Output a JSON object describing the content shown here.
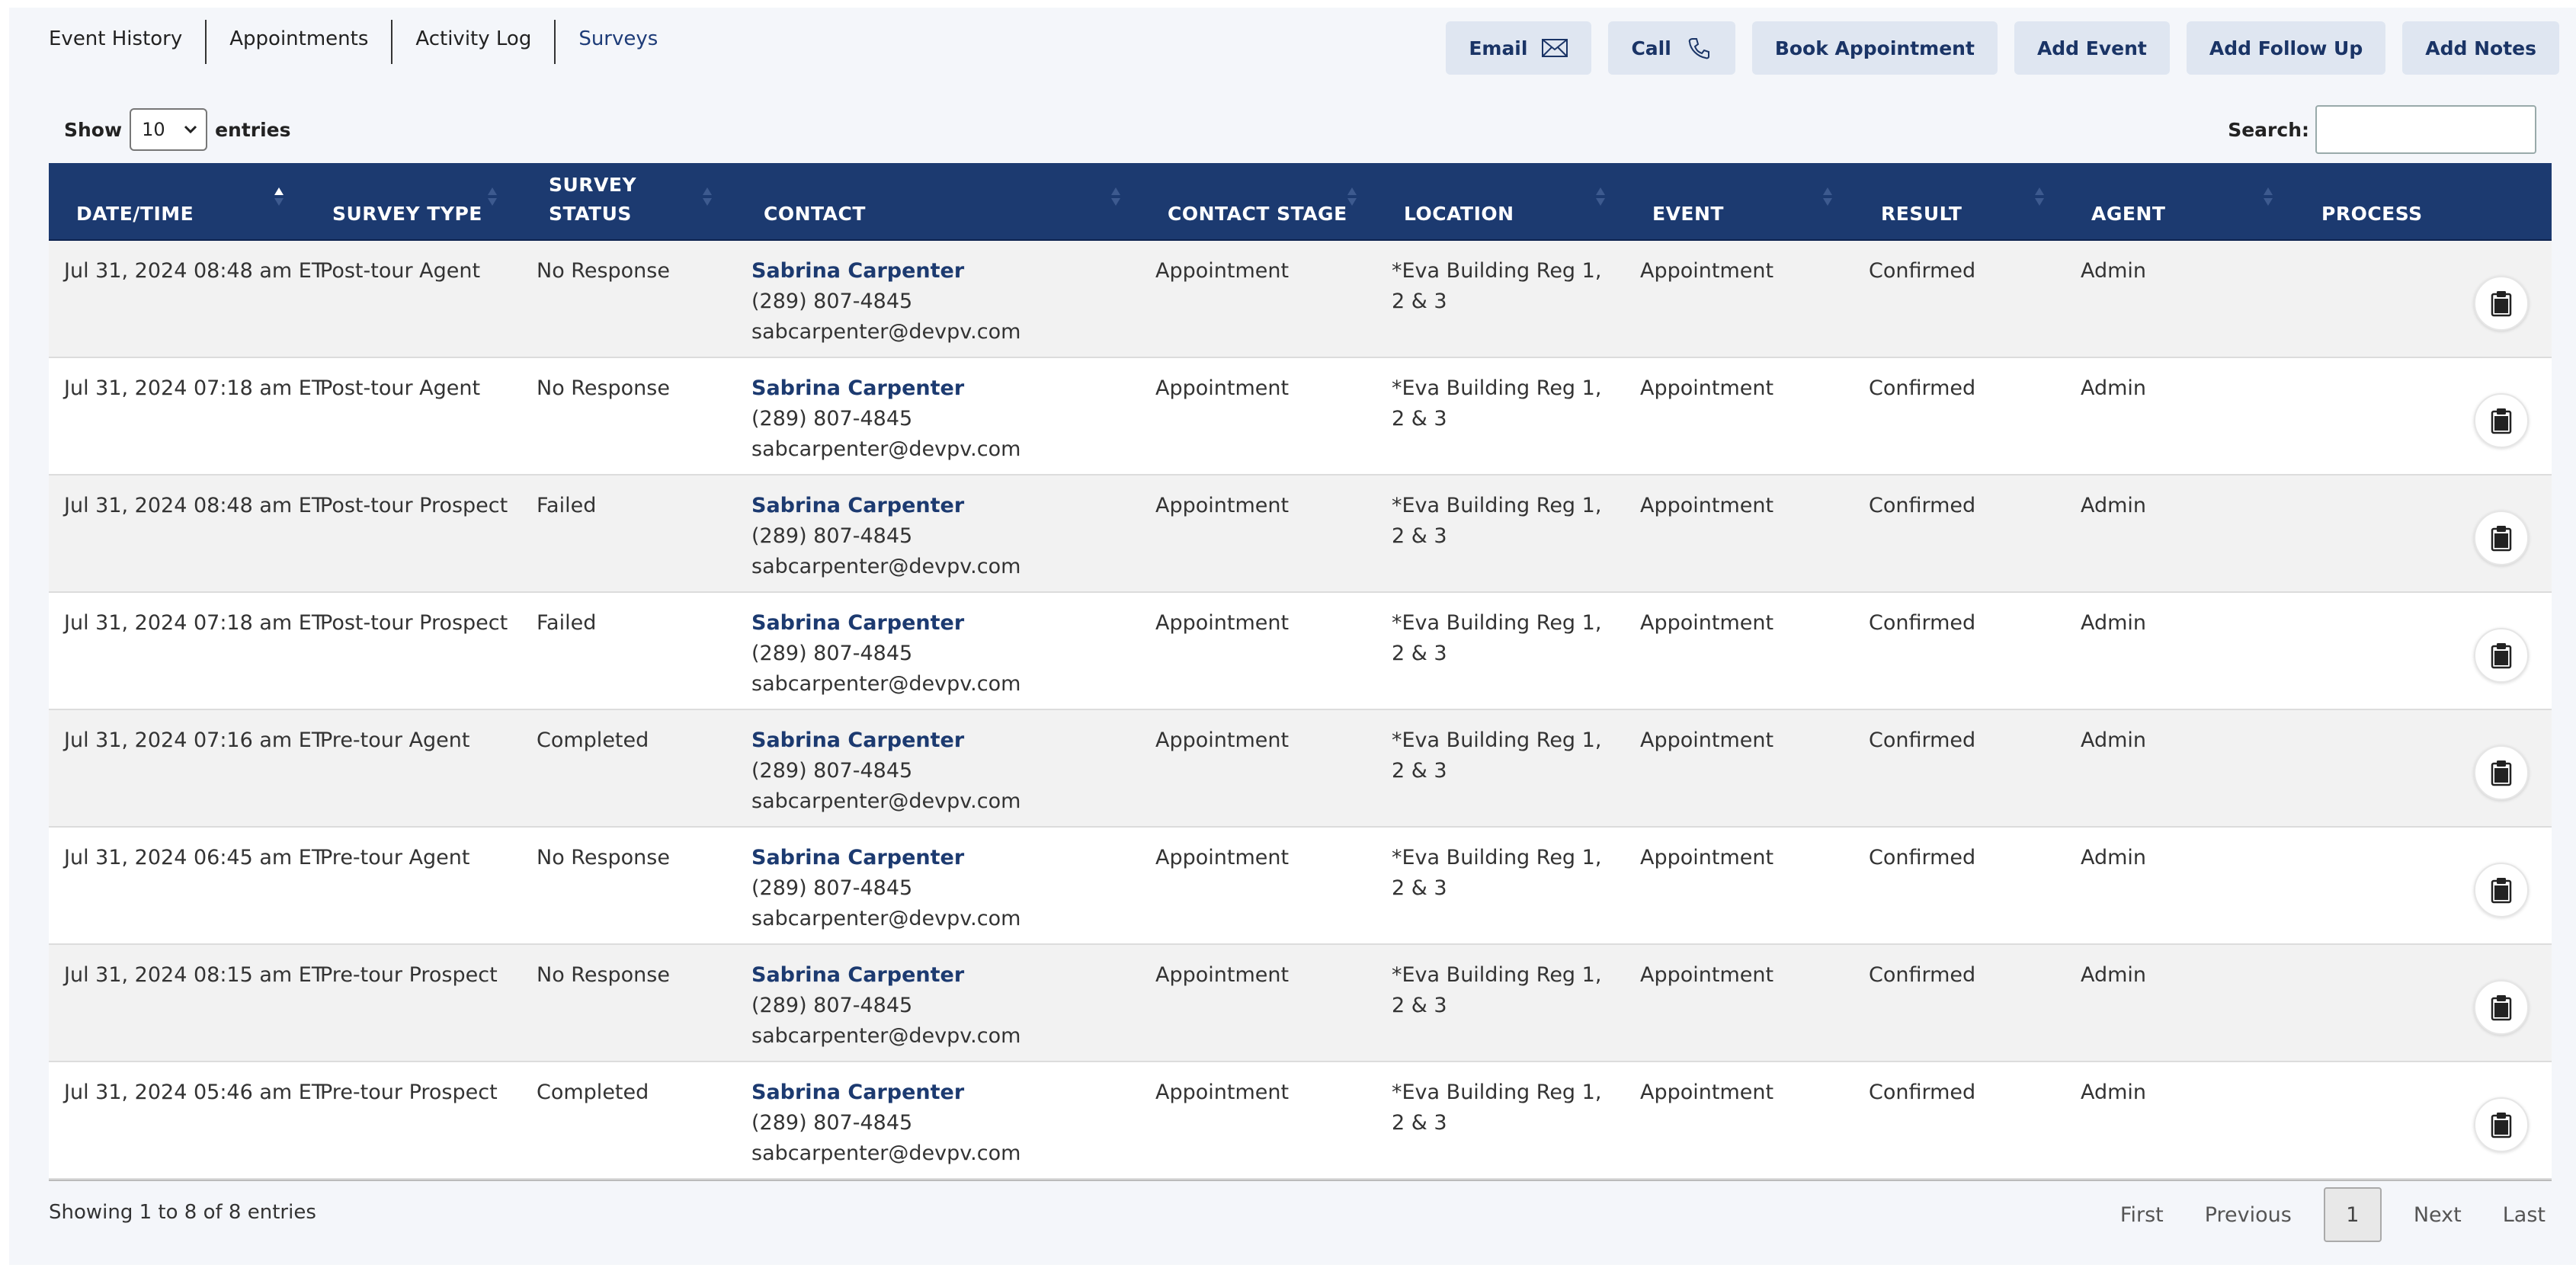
{
  "tabs": [
    {
      "label": "Event History",
      "active": false
    },
    {
      "label": "Appointments",
      "active": false
    },
    {
      "label": "Activity Log",
      "active": false
    },
    {
      "label": "Surveys",
      "active": true
    }
  ],
  "actions": {
    "email": "Email",
    "call": "Call",
    "book_appointment": "Book Appointment",
    "add_event": "Add Event",
    "add_follow_up": "Add Follow Up",
    "add_notes": "Add Notes"
  },
  "length": {
    "show_label": "Show",
    "value": "10",
    "entries_label": "entries"
  },
  "search": {
    "label": "Search:",
    "value": ""
  },
  "columns": {
    "datetime": "DATE/TIME",
    "survey_type": "SURVEY TYPE",
    "survey_status_1": "SURVEY",
    "survey_status_2": "STATUS",
    "contact": "CONTACT",
    "contact_stage": "CONTACT STAGE",
    "location": "LOCATION",
    "event": "EVENT",
    "result": "RESULT",
    "agent": "AGENT",
    "process": "PROCESS"
  },
  "rows": [
    {
      "datetime": "Jul 31, 2024 08:48 am ET",
      "survey_type": "Post-tour Agent",
      "survey_status": "No Response",
      "contact_name": "Sabrina Carpenter",
      "contact_phone": "(289) 807-4845",
      "contact_email": "sabcarpenter@devpv.com",
      "contact_stage": "Appointment",
      "location": "*Eva Building Reg 1, 2 & 3",
      "event": "Appointment",
      "result": "Confirmed",
      "agent": "Admin"
    },
    {
      "datetime": "Jul 31, 2024 07:18 am ET",
      "survey_type": "Post-tour Agent",
      "survey_status": "No Response",
      "contact_name": "Sabrina Carpenter",
      "contact_phone": "(289) 807-4845",
      "contact_email": "sabcarpenter@devpv.com",
      "contact_stage": "Appointment",
      "location": "*Eva Building Reg 1, 2 & 3",
      "event": "Appointment",
      "result": "Confirmed",
      "agent": "Admin"
    },
    {
      "datetime": "Jul 31, 2024 08:48 am ET",
      "survey_type": "Post-tour Prospect",
      "survey_status": "Failed",
      "contact_name": "Sabrina Carpenter",
      "contact_phone": "(289) 807-4845",
      "contact_email": "sabcarpenter@devpv.com",
      "contact_stage": "Appointment",
      "location": "*Eva Building Reg 1, 2 & 3",
      "event": "Appointment",
      "result": "Confirmed",
      "agent": "Admin"
    },
    {
      "datetime": "Jul 31, 2024 07:18 am ET",
      "survey_type": "Post-tour Prospect",
      "survey_status": "Failed",
      "contact_name": "Sabrina Carpenter",
      "contact_phone": "(289) 807-4845",
      "contact_email": "sabcarpenter@devpv.com",
      "contact_stage": "Appointment",
      "location": "*Eva Building Reg 1, 2 & 3",
      "event": "Appointment",
      "result": "Confirmed",
      "agent": "Admin"
    },
    {
      "datetime": "Jul 31, 2024 07:16 am ET",
      "survey_type": "Pre-tour Agent",
      "survey_status": "Completed",
      "contact_name": "Sabrina Carpenter",
      "contact_phone": "(289) 807-4845",
      "contact_email": "sabcarpenter@devpv.com",
      "contact_stage": "Appointment",
      "location": "*Eva Building Reg 1, 2 & 3",
      "event": "Appointment",
      "result": "Confirmed",
      "agent": "Admin"
    },
    {
      "datetime": "Jul 31, 2024 06:45 am ET",
      "survey_type": "Pre-tour Agent",
      "survey_status": "No Response",
      "contact_name": "Sabrina Carpenter",
      "contact_phone": "(289) 807-4845",
      "contact_email": "sabcarpenter@devpv.com",
      "contact_stage": "Appointment",
      "location": "*Eva Building Reg 1, 2 & 3",
      "event": "Appointment",
      "result": "Confirmed",
      "agent": "Admin"
    },
    {
      "datetime": "Jul 31, 2024 08:15 am ET",
      "survey_type": "Pre-tour Prospect",
      "survey_status": "No Response",
      "contact_name": "Sabrina Carpenter",
      "contact_phone": "(289) 807-4845",
      "contact_email": "sabcarpenter@devpv.com",
      "contact_stage": "Appointment",
      "location": "*Eva Building Reg 1, 2 & 3",
      "event": "Appointment",
      "result": "Confirmed",
      "agent": "Admin"
    },
    {
      "datetime": "Jul 31, 2024 05:46 am ET",
      "survey_type": "Pre-tour Prospect",
      "survey_status": "Completed",
      "contact_name": "Sabrina Carpenter",
      "contact_phone": "(289) 807-4845",
      "contact_email": "sabcarpenter@devpv.com",
      "contact_stage": "Appointment",
      "location": "*Eva Building Reg 1, 2 & 3",
      "event": "Appointment",
      "result": "Confirmed",
      "agent": "Admin"
    }
  ],
  "footer": {
    "info": "Showing 1 to 8 of 8 entries",
    "first": "First",
    "previous": "Previous",
    "current_page": "1",
    "next": "Next",
    "last": "Last"
  },
  "colors": {
    "header_bg": "#1c3a70",
    "accent": "#1e3c78",
    "button_bg": "#dfe6f1"
  }
}
